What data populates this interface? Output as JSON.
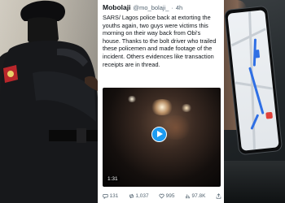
{
  "tweet": {
    "author_name": "Mobolaji",
    "handle": "@mo_bolaji_",
    "time": "4h",
    "body": "SARS/ Lagos police back at extorting the youths again, two guys were victims this morning on their way back from Obi's house. Thanks to the bolt driver who trailed these policemen and made footage of the incident. Others evidences like transaction receipts are in thread.",
    "video_duration": "1:31",
    "actions": {
      "replies": "131",
      "retweets": "1,037",
      "likes": "995",
      "views": "97.8K"
    }
  },
  "icons": [
    "reply-icon",
    "retweet-icon",
    "like-icon",
    "views-icon",
    "share-icon",
    "play-icon"
  ],
  "colors": {
    "accent": "#1d9bf0",
    "text": "#0f1419",
    "muted": "#536471",
    "route": "#2f6fe4",
    "pin": "#e0403a"
  }
}
